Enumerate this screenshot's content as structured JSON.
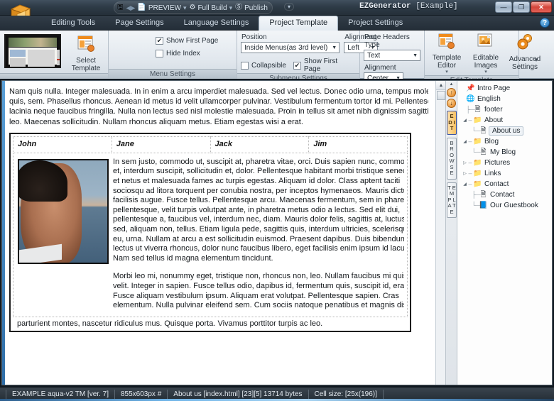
{
  "titlebar": {
    "app_icon": "ezgenerator-logo-icon",
    "quick_access": [
      {
        "icon": "save-icon",
        "label": ""
      },
      {
        "icon": "undo-redo-icon",
        "label": ""
      },
      {
        "icon": "page-icon",
        "label": "PREVIEW"
      },
      {
        "icon": "gear-icon",
        "label": "Full Build"
      },
      {
        "icon": "publish-icon",
        "label": "Publish"
      }
    ],
    "preview_label": "PREVIEW",
    "full_build_label": "Full Build",
    "publish_label": "Publish",
    "dropdown_caret": "▾",
    "app_name": "EZGenerator",
    "document_name": "[Example]",
    "minimize": "—",
    "maximize": "❐",
    "close": "✕"
  },
  "tabs": [
    {
      "label": "Editing Tools",
      "active": false
    },
    {
      "label": "Page Settings",
      "active": false
    },
    {
      "label": "Language Settings",
      "active": false
    },
    {
      "label": "Project Template",
      "active": true
    },
    {
      "label": "Project Settings",
      "active": false
    }
  ],
  "help_icon_label": "?",
  "ribbon": {
    "groups": [
      {
        "title": "",
        "name": "template-preview-group"
      },
      {
        "title": "Menu Settings",
        "name": "menu-settings-group"
      },
      {
        "title": "Submenu Settings",
        "name": "submenu-settings-group"
      },
      {
        "title": "Page Headers",
        "name": "page-headers-group"
      },
      {
        "title": "Edit Template",
        "name": "edit-template-group"
      }
    ],
    "select_template": {
      "line1": "Select",
      "line2": "Template",
      "icon": "template-icon"
    },
    "menu_settings": {
      "show_first_page_label": "Show First Page",
      "show_first_page_checked": "✔",
      "hide_index_label": "Hide Index",
      "hide_index_checked": ""
    },
    "submenu_settings": {
      "position_label": "Position",
      "position_value": "Inside Menus(as 3rd level)",
      "alignment_label": "Alignment",
      "alignment_value": "Left",
      "collapsible_label": "Collapsible",
      "collapsible_checked": "",
      "show_first_page_label": "Show First Page",
      "show_first_page_checked": "✔"
    },
    "page_headers": {
      "type_label": "Page Headers Type",
      "type_value": "Text",
      "alignment_label": "Alignment",
      "alignment_value": "Center"
    },
    "edit_template": {
      "template_editor_l1": "Template",
      "template_editor_l2": "Editor",
      "editable_images_l1": "Editable",
      "editable_images_l2": "Images",
      "advanced_settings_l1": "Advanced",
      "advanced_settings_l2": "Settings",
      "caret": "▾",
      "overflow_caret": "▾"
    }
  },
  "rail": {
    "scroll_up": "▲",
    "btn_top": "↑",
    "btn_bottom": "↓",
    "tabs": [
      {
        "label": "E D I T",
        "name": "rail-tab-edit",
        "active": true
      },
      {
        "label": "B R O W S E",
        "name": "rail-tab-browse",
        "active": false
      },
      {
        "label": "T E M P L A T E",
        "name": "rail-tab-template",
        "active": false
      }
    ]
  },
  "scrollbar": {
    "up": "▲",
    "down": "▼"
  },
  "tree": {
    "items": [
      {
        "label": "Intro Page",
        "icon": "pin-icon",
        "indent": 0,
        "expander": "",
        "guide": "",
        "selected": false
      },
      {
        "label": "English",
        "icon": "globe-icon",
        "indent": 0,
        "expander": "",
        "guide": "",
        "selected": false
      },
      {
        "label": "footer",
        "icon": "page-icon",
        "indent": 1,
        "expander": "",
        "guide": "├─",
        "selected": false
      },
      {
        "label": "About",
        "icon": "folder-icon",
        "indent": 1,
        "expander": "◢",
        "guide": "",
        "selected": false
      },
      {
        "label": "About us",
        "icon": "page-icon",
        "indent": 2,
        "expander": "",
        "guide": "└─",
        "selected": true
      },
      {
        "label": "Blog",
        "icon": "folder-icon",
        "indent": 1,
        "expander": "◢",
        "guide": "",
        "selected": false
      },
      {
        "label": "My Blog",
        "icon": "blog-icon",
        "indent": 2,
        "expander": "",
        "guide": "└─",
        "selected": false
      },
      {
        "label": "Pictures",
        "icon": "folder-icon",
        "indent": 1,
        "expander": "▷",
        "guide": "",
        "selected": false
      },
      {
        "label": "Links",
        "icon": "folder-icon",
        "indent": 1,
        "expander": "▷",
        "guide": "",
        "selected": false
      },
      {
        "label": "Contact",
        "icon": "folder-icon",
        "indent": 1,
        "expander": "◢",
        "guide": "",
        "selected": false
      },
      {
        "label": "Contact",
        "icon": "page-icon",
        "indent": 2,
        "expander": "",
        "guide": "├─",
        "selected": false
      },
      {
        "label": "Our Guestbook",
        "icon": "guestbook-icon",
        "indent": 2,
        "expander": "",
        "guide": "└─",
        "selected": false
      }
    ]
  },
  "document": {
    "intro_lines": [
      "Nam quis nulla. Integer malesuada. In in enim a arcu imperdiet malesuada. Sed vel lectus. Donec odio urna, tempus molestie,",
      "quis, sem. Phasellus rhoncus. Aenean id metus id velit ullamcorper pulvinar. Vestibulum fermentum tortor id mi. Pellentesque i",
      "lacinia neque faucibus fringilla. Nulla non lectus sed nisl molestie malesuada. Proin in tellus sit amet nibh dignissim sagittis. Viv",
      "leo. Maecenas sollicitudin. Nullam rhoncus aliquam metus. Etiam egestas wisi a erat."
    ],
    "table_headers": [
      "John",
      "Jane",
      "Jack",
      "Jim"
    ],
    "photo_alt": "man-profile-photo",
    "paragraph1_lines": [
      "In sem justo, commodo ut, suscipit at, pharetra vitae, orci. Duis sapien nunc, commodo",
      "et, interdum suscipit, sollicitudin et, dolor. Pellentesque habitant morbi tristique senectus",
      "et netus et malesuada fames ac turpis egestas. Aliquam id dolor. Class aptent taciti",
      "sociosqu ad litora torquent per conubia nostra, per inceptos hymenaeos. Mauris dictum",
      "facilisis augue. Fusce tellus. Pellentesque arcu. Maecenas fermentum, sem in pharetra",
      "pellentesque, velit turpis volutpat ante, in pharetra metus odio a lectus. Sed elit dui,",
      "pellentesque a, faucibus vel, interdum nec, diam. Mauris dolor felis, sagittis at, luctus",
      "sed, aliquam non, tellus. Etiam ligula pede, sagittis quis, interdum ultricies, scelerisque",
      "eu, urna. Nullam at arcu a est sollicitudin euismod. Praesent dapibus. Duis bibendum,",
      "lectus ut viverra rhoncus, dolor nunc faucibus libero, eget facilisis enim ipsum id lacus.",
      "Nam sed tellus id magna elementum tincidunt."
    ],
    "paragraph2_lines": [
      "Morbi leo mi, nonummy eget, tristique non, rhoncus non, leo. Nullam faucibus mi quis",
      "velit. Integer in sapien. Fusce tellus odio, dapibus id, fermentum quis, suscipit id, erat.",
      "Fusce aliquam vestibulum ipsum. Aliquam erat volutpat. Pellentesque sapien. Cras",
      "elementum. Nulla pulvinar eleifend sem. Cum sociis natoque penatibus et magnis dis"
    ],
    "tail_line": "parturient montes, nascetur ridiculus mus. Quisque porta. Vivamus porttitor turpis ac leo."
  },
  "statusbar": {
    "cells": [
      "EXAMPLE aqua-v2 TM [ver. 7]",
      "855x603px #",
      "About us [index.html] [23][5] 13714 bytes",
      "Cell size: [25x(196)]"
    ]
  },
  "colors": {
    "accent_orange": "#e07d18",
    "accent_blue": "#2f6ea8",
    "chrome_dark": "#2e3b47",
    "ribbon_bg": "#e2e8ee"
  }
}
